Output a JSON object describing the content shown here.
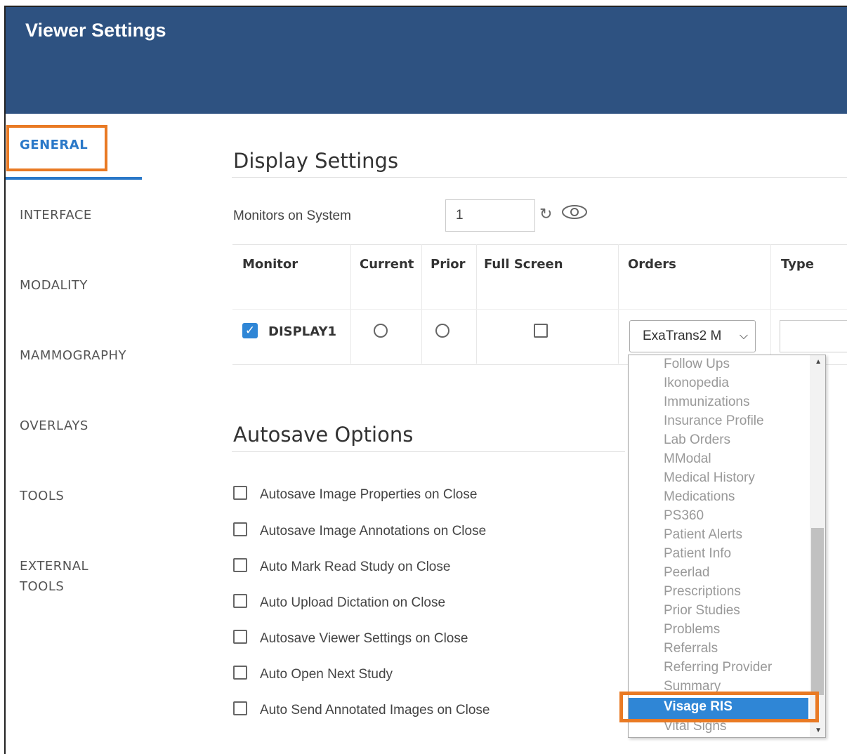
{
  "header": {
    "title": "Viewer Settings"
  },
  "sidebar": {
    "items": [
      {
        "label": "GENERAL"
      },
      {
        "label": "INTERFACE"
      },
      {
        "label": "MODALITY"
      },
      {
        "label": "MAMMOGRAPHY"
      },
      {
        "label": "OVERLAYS"
      },
      {
        "label": "TOOLS"
      },
      {
        "label": "EXTERNAL",
        "label2": "TOOLS"
      }
    ],
    "active": "GENERAL"
  },
  "display_settings": {
    "title": "Display Settings",
    "monitors_label": "Monitors on System",
    "monitors_value": "1",
    "table": {
      "headers": [
        "Monitor",
        "Current",
        "Prior",
        "Full Screen",
        "Orders",
        "Type"
      ],
      "row": {
        "monitor": "DISPLAY1",
        "monitor_checked": true,
        "current": false,
        "prior": false,
        "full_screen": false,
        "orders_value": "ExaTrans2 M"
      }
    }
  },
  "autosave": {
    "title": "Autosave Options",
    "options": [
      "Autosave Image Properties on Close",
      "Autosave Image Annotations on Close",
      "Auto Mark Read Study on Close",
      "Auto Upload Dictation on Close",
      "Autosave Viewer Settings on Close",
      "Auto Open Next Study",
      "Auto Send Annotated Images on Close"
    ]
  },
  "orders_dropdown": {
    "items": [
      "Follow Ups",
      "Ikonopedia",
      "Immunizations",
      "Insurance Profile",
      "Lab Orders",
      "MModal",
      "Medical History",
      "Medications",
      "PS360",
      "Patient Alerts",
      "Patient Info",
      "Peerlad",
      "Prescriptions",
      "Prior Studies",
      "Problems",
      "Referrals",
      "Referring Provider",
      "Summary"
    ],
    "selected": "Visage RIS",
    "after": "Vital Signs"
  },
  "colors": {
    "header": "#2e5281",
    "accent": "#2a78c8",
    "highlight": "#e97a24",
    "selected": "#2f86d6"
  }
}
